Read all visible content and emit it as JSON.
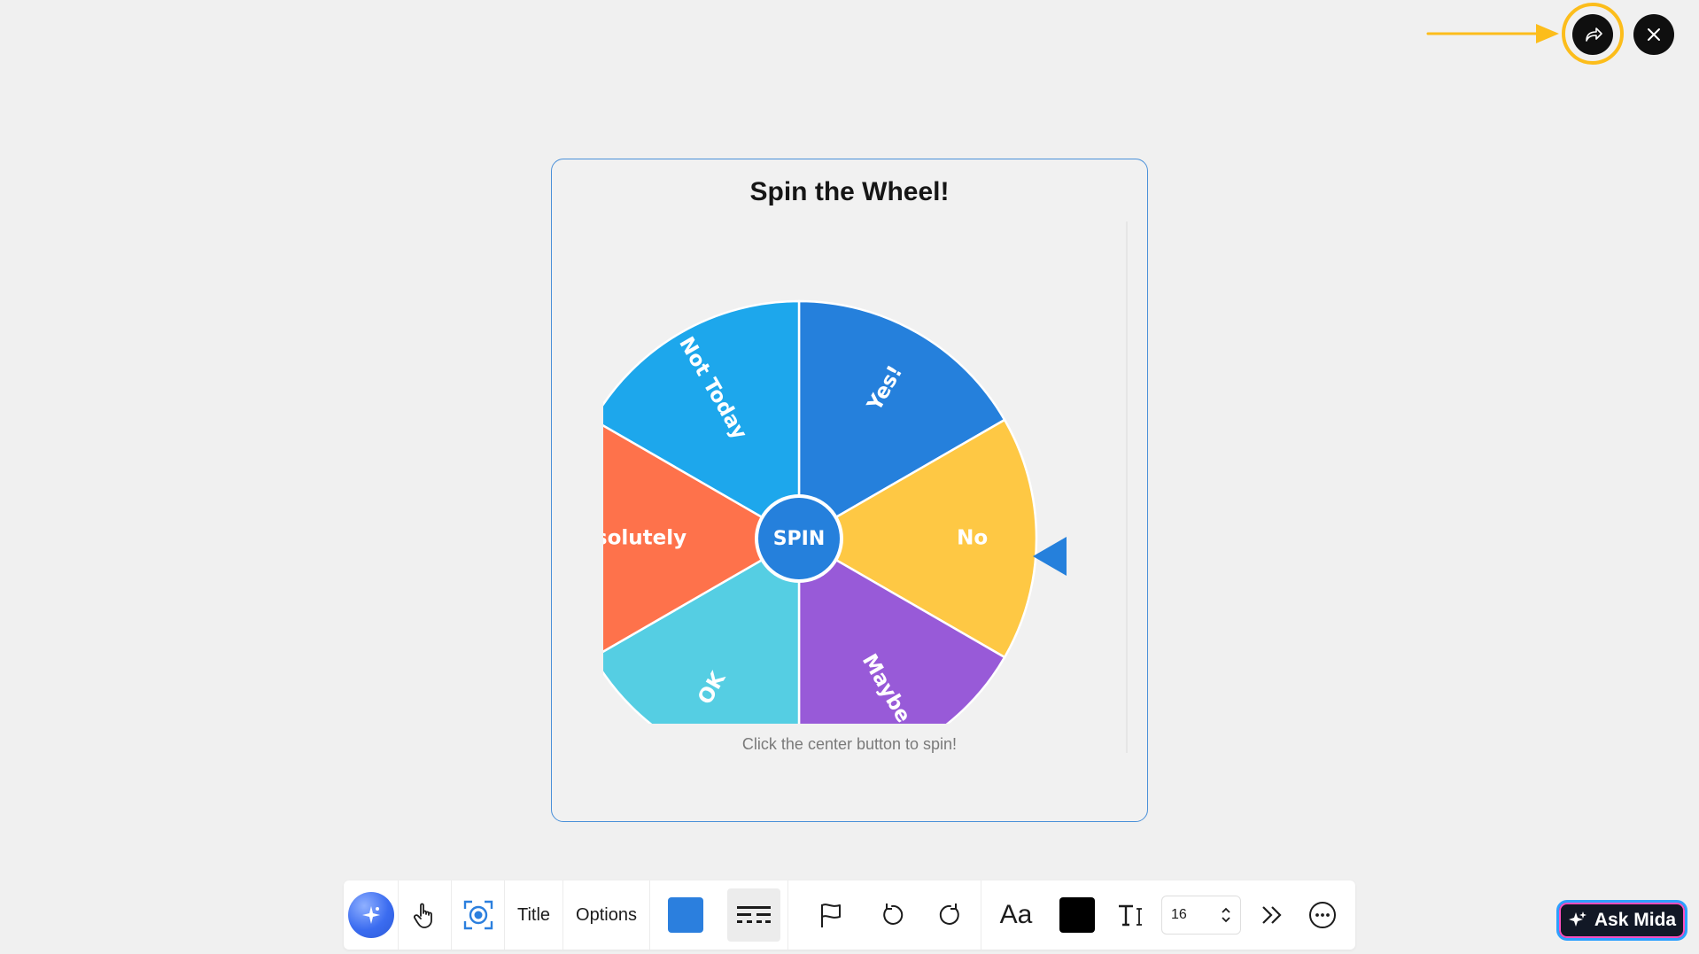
{
  "card": {
    "title": "Spin the Wheel!",
    "hint": "Click the center button to spin!",
    "center_label": "SPIN"
  },
  "wheel": {
    "segments": [
      {
        "label": "Yes!",
        "color": "#2580dc"
      },
      {
        "label": "No",
        "color": "#fec844"
      },
      {
        "label": "Maybe",
        "color": "#985ad8"
      },
      {
        "label": "OK",
        "color": "#55cee3"
      },
      {
        "label": "Absolutely",
        "color": "#fe724b"
      },
      {
        "label": "Not Today",
        "color": "#1da7ec"
      }
    ],
    "pointer_color": "#2580dc"
  },
  "toolbar": {
    "title_label": "Title",
    "options_label": "Options",
    "font_label": "Aa",
    "font_size": "16"
  },
  "ask_mida": {
    "label": "Ask Mida"
  },
  "colors": {
    "highlight": "#fcbd1b",
    "accent_blue": "#2b7fde"
  }
}
